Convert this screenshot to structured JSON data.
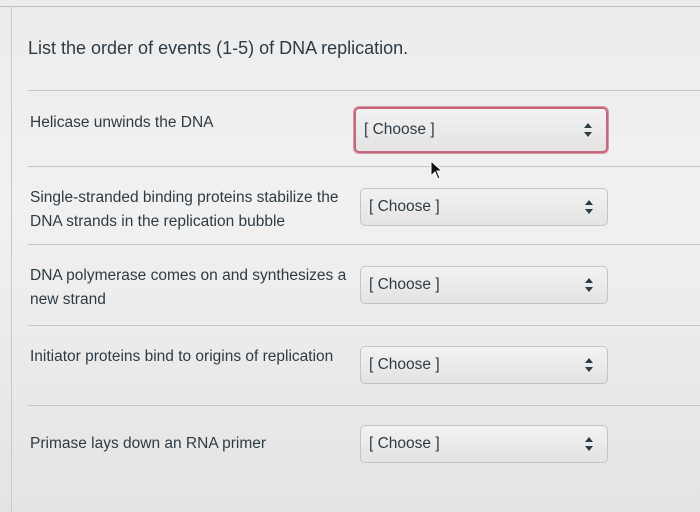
{
  "quiz": {
    "question": "List the order of events (1-5) of DNA replication.",
    "rows": [
      {
        "label": "Helicase unwinds the DNA",
        "selected": "[ Choose ]"
      },
      {
        "label": "Single-stranded binding proteins stabilize the DNA strands in the replication bubble",
        "selected": "[ Choose ]"
      },
      {
        "label": "DNA polymerase comes on and synthesizes a new strand",
        "selected": "[ Choose ]"
      },
      {
        "label": "Initiator proteins bind to origins of replication",
        "selected": "[ Choose ]"
      },
      {
        "label": "Primase lays down an RNA primer",
        "selected": "[ Choose ]"
      }
    ]
  },
  "icons": {
    "select_arrows": "up-down-arrows-icon",
    "pointer": "mouse-pointer-icon"
  },
  "colors": {
    "text": "#2d3b45",
    "focus_border": "#c5667b"
  }
}
